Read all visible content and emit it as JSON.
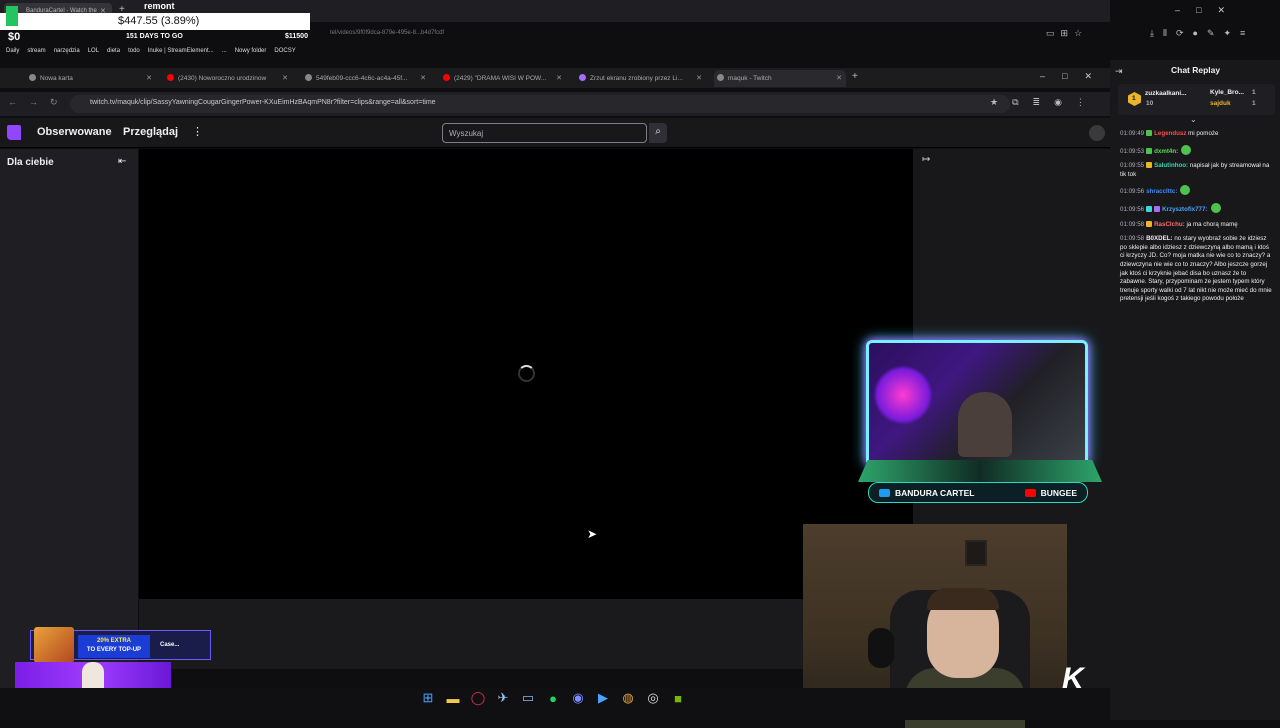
{
  "outer_browser": {
    "tab_title": "BanduraCartel - Watch the",
    "url_fragment": "tel/videos/9f0f9dca-879e-495e-8...b4d7fcdf",
    "window_controls": [
      "–",
      "□",
      "✕"
    ]
  },
  "stream_overlay": {
    "title": "remont",
    "price": "$447.55 (3.89%)",
    "current": "$0",
    "days_left": "151 DAYS TO GO",
    "goal": "$11500"
  },
  "bookmarks": [
    "Daily",
    "stream",
    "narzędzia",
    "LOL",
    "dieta",
    "todo",
    "Inuke | StreamElement...",
    "...",
    "Nowy folder",
    "DOCSY"
  ],
  "inner_browser": {
    "tabs": [
      {
        "title": "Nowa karta",
        "color": "#888888"
      },
      {
        "title": "(2430) Noworoczno urodzinow",
        "color": "#ff0000"
      },
      {
        "title": "549feb09-ccc6-4c6c-ac4a-45f...",
        "color": "#888888"
      },
      {
        "title": "(2429) \"DRAMA WISI W POW...",
        "color": "#ff0000"
      },
      {
        "title": "Zrzut ekranu zrobiony przez Li...",
        "color": "#a66cff"
      },
      {
        "title": "maquk - Twitch",
        "color": "#888888"
      }
    ],
    "url": "twitch.tv/maquk/clip/SassyYawningCougarGingerPower-KXuEimHzBAqmPN8r?filter=clips&range=all&sort=time"
  },
  "twitch": {
    "nav_followed": "Obserwowane",
    "nav_browse": "Przeglądaj",
    "nav_more": "⋮",
    "search_placeholder": "Wyszukaj",
    "sidebar_title": "Dla ciebie"
  },
  "chat": {
    "title": "Chat Replay",
    "top_gifter_rank": "1",
    "top_gifter_name": "zuzkaalkani...",
    "top_gifter_count": "10",
    "top_user_1": "Kyle_Bro...",
    "top_user_1_count": "1",
    "top_user_2": "sajduk",
    "top_user_2_count": "1",
    "messages": [
      {
        "time": "01:09:49",
        "user": "Legendusz",
        "color": "#ff4b4b",
        "text": "mi pomoże",
        "emote": false
      },
      {
        "time": "01:09:53",
        "user": "dxmt4n:",
        "color": "#5cd65c",
        "text": "",
        "emote": true
      },
      {
        "time": "01:09:55",
        "user": "Salutinhoo:",
        "color": "#3bd6b0",
        "text": "napisał jak by streamował na tik tok",
        "emote": false
      },
      {
        "time": "01:09:56",
        "user": "shracclttc:",
        "color": "#3c8bff",
        "text": "",
        "emote": true
      },
      {
        "time": "01:09:56",
        "user": "Krzysztofix777:",
        "color": "#4aa3ff",
        "text": "",
        "emote": true
      },
      {
        "time": "01:09:58",
        "user": "RasClchu:",
        "color": "#ff6b6b",
        "text": "ja ma chorą mamę",
        "emote": false
      },
      {
        "time": "01:09:58",
        "user": "B0XDEL:",
        "color": "#efeff1",
        "text": "no stary wyobraź sobie że idziesz po sklepie albo idziesz z dziewczyną albo mamą i ktoś ci krzyczy JD. Co? moja matka nie wie co to znaczy? a dziewczyna nie wie co to znaczy? Albo jeszcze gorzej jak ktoś ci krzyknie jebać disa bo uznasz że to zabawne. Stary, przypominam że jestem typem który trenuje sporty walki od 7 lat nikt nie może mieć do mnie pretensji jeśli kogoś z takiego powodu położe",
        "emote": false
      }
    ]
  },
  "cam_overlay": {
    "social_1": "BANDURA CARTEL",
    "social_2": "BUNGEE",
    "social_1_color": "#1d9bf0",
    "social_2_color": "#ff0000"
  },
  "promo": {
    "headline": "20% EXTRA",
    "subline": "TO EVERY TOP-UP",
    "brand": "Case..."
  },
  "webcam_badge": "K",
  "taskbar_icons": [
    "windows-icon",
    "folder-icon",
    "opera-icon",
    "steam-icon",
    "monitor-icon",
    "spotify-icon",
    "discord-icon",
    "player-icon",
    "chrome-icon",
    "obs-icon",
    "nvidia-icon"
  ]
}
